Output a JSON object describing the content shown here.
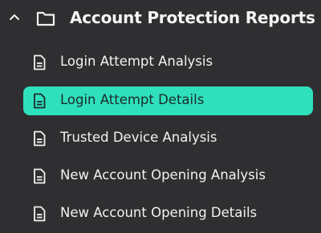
{
  "group": {
    "title": "Account Protection Reports",
    "expanded": true,
    "chevron_icon": "chevron-up-icon",
    "folder_icon": "folder-icon"
  },
  "items": [
    {
      "label": "Login Attempt Analysis",
      "icon": "document-icon",
      "active": false
    },
    {
      "label": "Login Attempt Details",
      "icon": "document-icon",
      "active": true
    },
    {
      "label": "Trusted Device Analysis",
      "icon": "document-icon",
      "active": false
    },
    {
      "label": "New Account Opening Analysis",
      "icon": "document-icon",
      "active": false
    },
    {
      "label": "New Account Opening Details",
      "icon": "document-icon",
      "active": false
    }
  ],
  "colors": {
    "background": "#2f2f31",
    "text": "#f2f2f2",
    "active_background": "#2fe0bd",
    "active_text": "#1e2a2a"
  }
}
